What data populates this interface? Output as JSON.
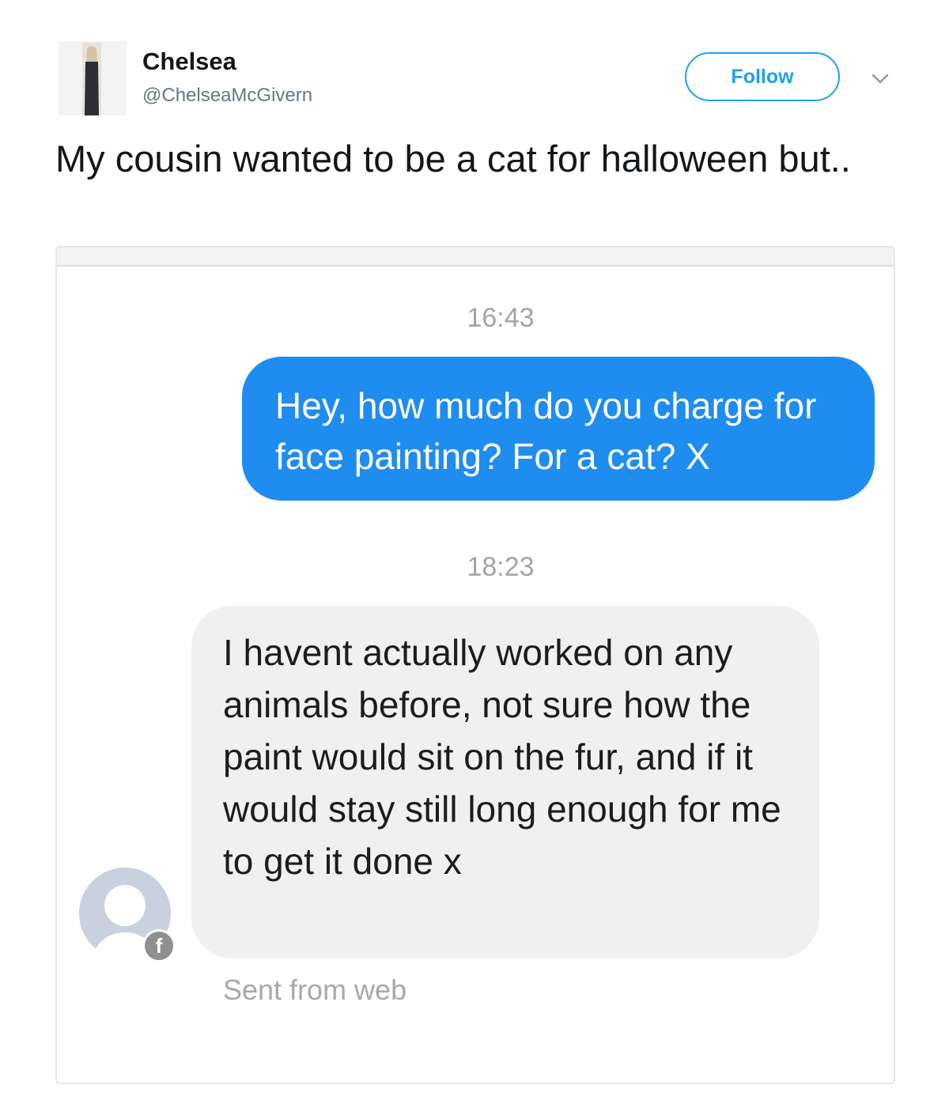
{
  "tweet": {
    "author_name": "Chelsea",
    "author_handle": "@ChelseaMcGivern",
    "follow_label": "Follow",
    "text": "My cousin wanted to be a cat for halloween but..",
    "menu_icon": "chevron-down-icon"
  },
  "conversation": {
    "timestamp_1": "16:43",
    "outgoing_message": "Hey, how much do you charge for face painting? For a cat? X",
    "timestamp_2": "18:23",
    "incoming_message": "I havent actually worked on any animals before, not sure how the paint would sit on the fur, and if it would stay still long enough for me to get it done x",
    "sent_from": "Sent from web",
    "badge_glyph": "f",
    "sender_avatar_icon": "default-profile-icon",
    "badge_icon": "facebook-icon"
  },
  "colors": {
    "follow_blue": "#1da1f2",
    "outgoing_bubble": "#1f8cf0",
    "incoming_bubble": "#f0f0f0"
  }
}
